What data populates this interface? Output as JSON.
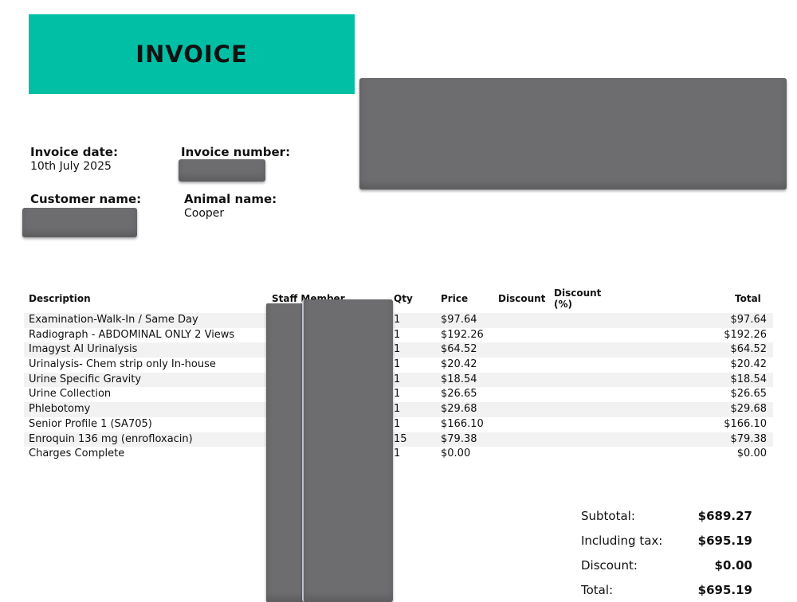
{
  "header": {
    "title": "INVOICE"
  },
  "meta": {
    "invoice_date_label": "Invoice date:",
    "invoice_date": "10th July 2025",
    "invoice_number_label": "Invoice number:",
    "customer_name_label": "Customer name:",
    "animal_name_label": "Animal name:",
    "animal_name": "Cooper"
  },
  "table": {
    "headers": {
      "description": "Description",
      "staff_member": "Staff Member",
      "qty": "Qty",
      "price": "Price",
      "discount": "Discount",
      "discount_pct_line1": "Discount",
      "discount_pct_line2": "(%)",
      "total": "Total"
    },
    "rows": [
      {
        "description": "Examination-Walk-In / Same Day",
        "qty": "1",
        "price": "$97.64",
        "total": "$97.64"
      },
      {
        "description": "Radiograph - ABDOMINAL ONLY 2 Views",
        "qty": "1",
        "price": "$192.26",
        "total": "$192.26"
      },
      {
        "description": "Imagyst AI Urinalysis",
        "qty": "1",
        "price": "$64.52",
        "total": "$64.52"
      },
      {
        "description": "Urinalysis- Chem strip only In-house",
        "qty": "1",
        "price": "$20.42",
        "total": "$20.42"
      },
      {
        "description": "Urine Specific Gravity",
        "qty": "1",
        "price": "$18.54",
        "total": "$18.54"
      },
      {
        "description": "Urine Collection",
        "qty": "1",
        "price": "$26.65",
        "total": "$26.65"
      },
      {
        "description": "Phlebotomy",
        "qty": "1",
        "price": "$29.68",
        "total": "$29.68"
      },
      {
        "description": "Senior Profile 1 (SA705)",
        "qty": "1",
        "price": "$166.10",
        "total": "$166.10"
      },
      {
        "description": "Enroquin 136 mg (enrofloxacin)",
        "qty": "15",
        "price": "$79.38",
        "total": "$79.38"
      },
      {
        "description": "Charges Complete",
        "qty": "1",
        "price": "$0.00",
        "total": "$0.00"
      }
    ]
  },
  "summary": {
    "subtotal_label": "Subtotal:",
    "subtotal": "$689.27",
    "including_tax_label": "Including tax:",
    "including_tax": "$695.19",
    "discount_label": "Discount:",
    "discount": "$0.00",
    "total_label": "Total:",
    "total": "$695.19"
  },
  "colors": {
    "banner": "#00bfa5",
    "redaction": "#6d6d70",
    "row_stripe": "#f2f2f2"
  }
}
